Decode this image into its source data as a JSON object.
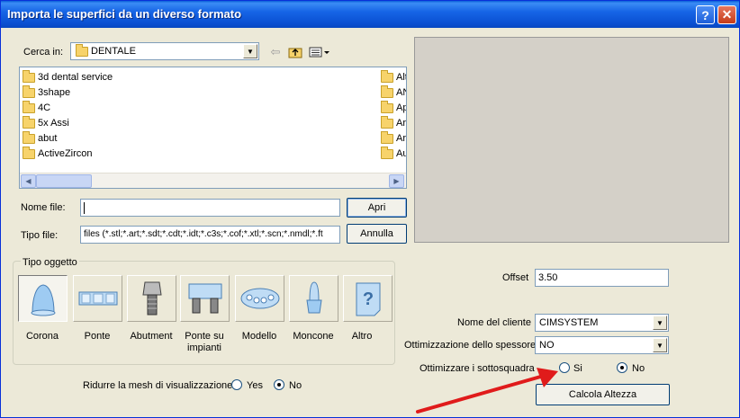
{
  "window": {
    "title": "Importa le superfici da un diverso formato",
    "help_label": "?",
    "close_label": "✕"
  },
  "lookin": {
    "label": "Cerca in:",
    "value": "DENTALE"
  },
  "files": {
    "left": [
      "3d dental service",
      "3shape",
      "4C",
      "5x Assi",
      "abut",
      "ActiveZircon"
    ],
    "right": [
      "Alt",
      "AN",
      "Ap",
      "Ar",
      "Ar",
      "Au"
    ]
  },
  "filename": {
    "label": "Nome file:",
    "value": ""
  },
  "filetype": {
    "label": "Tipo file:",
    "value": "files (*.stl;*.art;*.sdt;*.cdt;*.idt;*.c3s;*.cof;*.xtl;*.scn;*.nmdl;*.ft"
  },
  "buttons": {
    "open": "Apri",
    "cancel": "Annulla",
    "calc_height": "Calcola Altezza"
  },
  "object_group": {
    "legend": "Tipo oggetto",
    "types": [
      {
        "label": "Corona",
        "icon": "crown-icon",
        "selected": true
      },
      {
        "label": "Ponte",
        "icon": "bridge-icon"
      },
      {
        "label": "Abutment",
        "icon": "abutment-icon"
      },
      {
        "label": "Ponte su impianti",
        "icon": "implant-bridge-icon"
      },
      {
        "label": "Modello",
        "icon": "model-icon"
      },
      {
        "label": "Moncone",
        "icon": "stump-icon"
      },
      {
        "label": "Altro",
        "icon": "question-icon"
      }
    ]
  },
  "mesh": {
    "label": "Ridurre la mesh di visualizzazione",
    "yes": "Yes",
    "no": "No",
    "selected": "No"
  },
  "offset": {
    "label": "Offset",
    "value": "3.50"
  },
  "client": {
    "label": "Nome del cliente",
    "value": "CIMSYSTEM"
  },
  "thickness": {
    "label": "Ottimizzazione dello spessore",
    "value": "NO"
  },
  "undercuts": {
    "label": "Ottimizzare i sottosquadra",
    "yes": "Si",
    "no": "No",
    "selected": "No"
  },
  "annotation": {
    "arrow_color": "#e01b1b"
  }
}
